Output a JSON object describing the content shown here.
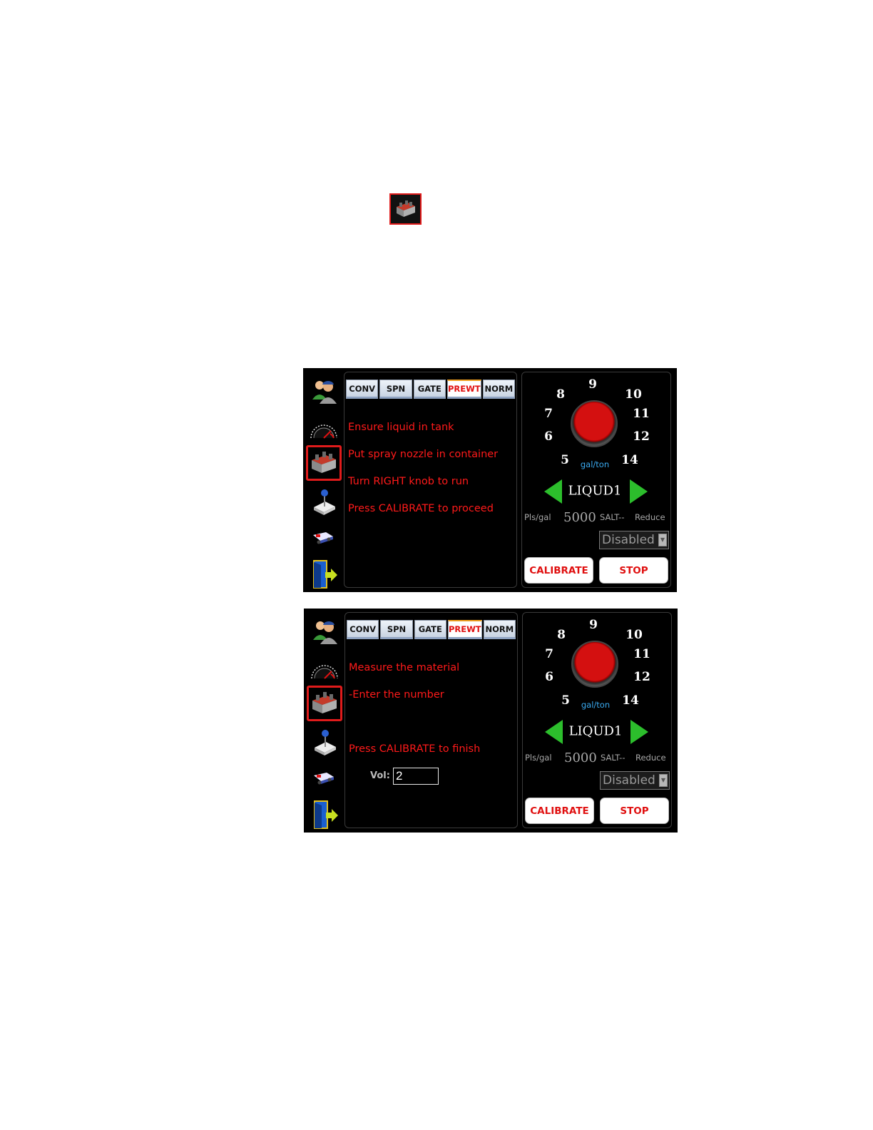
{
  "inline_icon": {
    "name": "valve-block-icon"
  },
  "screen1": {
    "tabs": [
      "CONV",
      "SPN",
      "GATE",
      "PREWT",
      "NORM"
    ],
    "active_tab": "PREWT",
    "instructions": [
      "Ensure liquid in tank",
      "Put spray nozzle in container",
      "Turn RIGHT knob to run",
      "Press CALIBRATE to proceed"
    ],
    "dial_numbers": [
      "9",
      "8",
      "10",
      "7",
      "11",
      "6",
      "12",
      "5",
      "14"
    ],
    "dial_unit": "gal/ton",
    "material": "LIQUD1",
    "pls_label": "Pls/gal",
    "pls_value": "5000",
    "salt_label": "SALT--",
    "reduce_label": "Reduce",
    "reduce_select": "Disabled",
    "calibrate_label": "CALIBRATE",
    "stop_label": "STOP"
  },
  "screen2": {
    "tabs": [
      "CONV",
      "SPN",
      "GATE",
      "PREWT",
      "NORM"
    ],
    "active_tab": "PREWT",
    "instructions": [
      "Measure the material",
      "-Enter the number",
      "Press CALIBRATE to finish"
    ],
    "vol_label": "Vol:",
    "vol_value": "2",
    "dial_numbers": [
      "9",
      "8",
      "10",
      "7",
      "11",
      "6",
      "12",
      "5",
      "14"
    ],
    "dial_unit": "gal/ton",
    "material": "LIQUD1",
    "pls_label": "Pls/gal",
    "pls_value": "5000",
    "salt_label": "SALT--",
    "reduce_label": "Reduce",
    "reduce_select": "Disabled",
    "calibrate_label": "CALIBRATE",
    "stop_label": "STOP"
  },
  "sidebar_icons": [
    "users-icon",
    "speedometer-icon",
    "valve-block-icon",
    "joystick-icon",
    "truck-icon",
    "exit-door-icon"
  ],
  "colors": {
    "accent_red": "#e01010",
    "arrow_green": "#2cbe2c",
    "unit_blue": "#3aaaf0"
  }
}
